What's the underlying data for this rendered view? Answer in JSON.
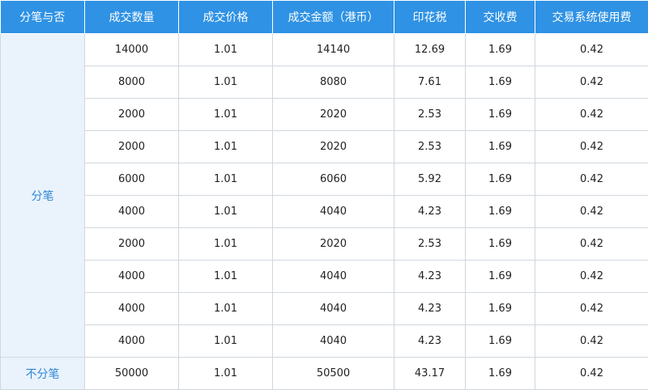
{
  "table": {
    "headers": [
      "分笔与否",
      "成交数量",
      "成交价格",
      "成交金额（港币）",
      "印花税",
      "交收费",
      "交易系统使用费"
    ],
    "groups": [
      {
        "label": "分笔",
        "rows": [
          [
            "14000",
            "1.01",
            "14140",
            "12.69",
            "1.69",
            "0.42"
          ],
          [
            "8000",
            "1.01",
            "8080",
            "7.61",
            "1.69",
            "0.42"
          ],
          [
            "2000",
            "1.01",
            "2020",
            "2.53",
            "1.69",
            "0.42"
          ],
          [
            "2000",
            "1.01",
            "2020",
            "2.53",
            "1.69",
            "0.42"
          ],
          [
            "6000",
            "1.01",
            "6060",
            "5.92",
            "1.69",
            "0.42"
          ],
          [
            "4000",
            "1.01",
            "4040",
            "4.23",
            "1.69",
            "0.42"
          ],
          [
            "2000",
            "1.01",
            "2020",
            "2.53",
            "1.69",
            "0.42"
          ],
          [
            "4000",
            "1.01",
            "4040",
            "4.23",
            "1.69",
            "0.42"
          ],
          [
            "4000",
            "1.01",
            "4040",
            "4.23",
            "1.69",
            "0.42"
          ],
          [
            "4000",
            "1.01",
            "4040",
            "4.23",
            "1.69",
            "0.42"
          ]
        ]
      },
      {
        "label": "不分笔",
        "rows": [
          [
            "50000",
            "1.01",
            "50500",
            "43.17",
            "1.69",
            "0.42"
          ]
        ]
      }
    ]
  }
}
